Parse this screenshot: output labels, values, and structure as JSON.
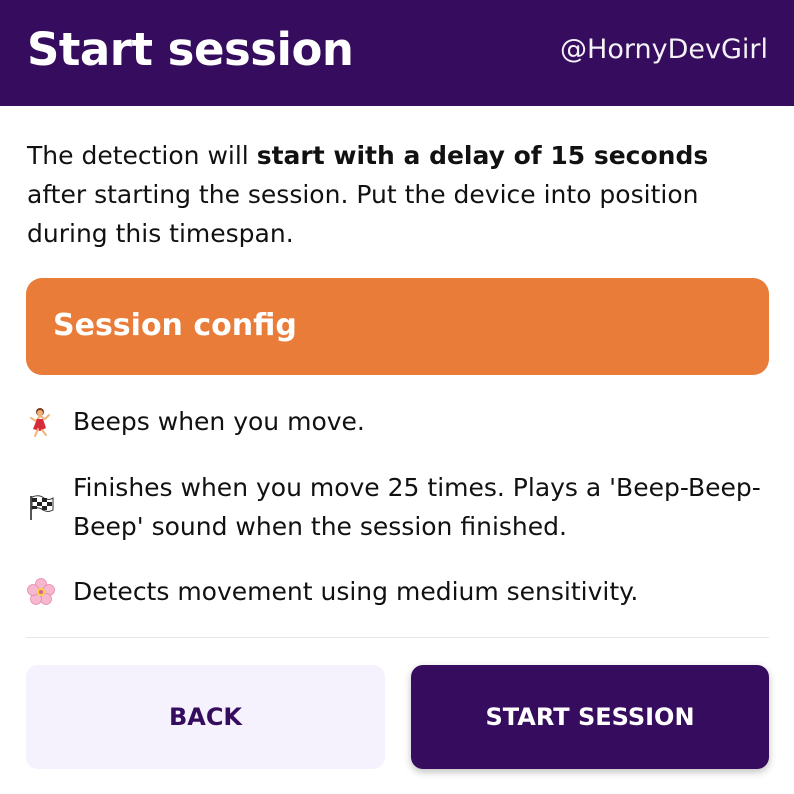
{
  "header": {
    "title": "Start session",
    "handle": "@HornyDevGirl"
  },
  "intro": {
    "before": "The detection will ",
    "bold": "start with a delay of 15 seconds",
    "after": " after starting the session. Put the device into position during this timespan."
  },
  "config": {
    "title": "Session config"
  },
  "features": [
    {
      "icon": "dancer-icon",
      "text": "Beeps when you move."
    },
    {
      "icon": "checkered-flag-icon",
      "text": "Finishes when you move 25 times. Plays a 'Beep-Beep-Beep' sound when the session finished."
    },
    {
      "icon": "cherry-blossom-icon",
      "text": "Detects movement using medium sensitivity."
    }
  ],
  "buttons": {
    "back": "BACK",
    "start": "START SESSION"
  },
  "colors": {
    "header_bg": "#360c5e",
    "config_bg": "#e97c38",
    "back_bg": "#f6f2fd",
    "start_bg": "#360c5e"
  }
}
